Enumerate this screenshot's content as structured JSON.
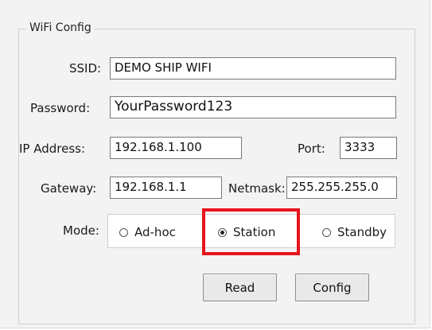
{
  "group": {
    "title": "WiFi Config"
  },
  "ssid": {
    "label": "SSID:",
    "value": "DEMO SHIP WIFI"
  },
  "password": {
    "label": "Password:",
    "value": "YourPassword123"
  },
  "ip": {
    "label": "IP Address:",
    "value": "192.168.1.100"
  },
  "port": {
    "label": "Port:",
    "value": "3333"
  },
  "gateway": {
    "label": "Gateway:",
    "value": "192.168.1.1"
  },
  "netmask": {
    "label": "Netmask:",
    "value": "255.255.255.0"
  },
  "mode": {
    "label": "Mode:",
    "options": [
      "Ad-hoc",
      "Station",
      "Standby"
    ],
    "selected": "Station"
  },
  "buttons": {
    "read": "Read",
    "config": "Config"
  },
  "colors": {
    "highlight": "#e8131b",
    "panel": "#f3f3f3"
  }
}
